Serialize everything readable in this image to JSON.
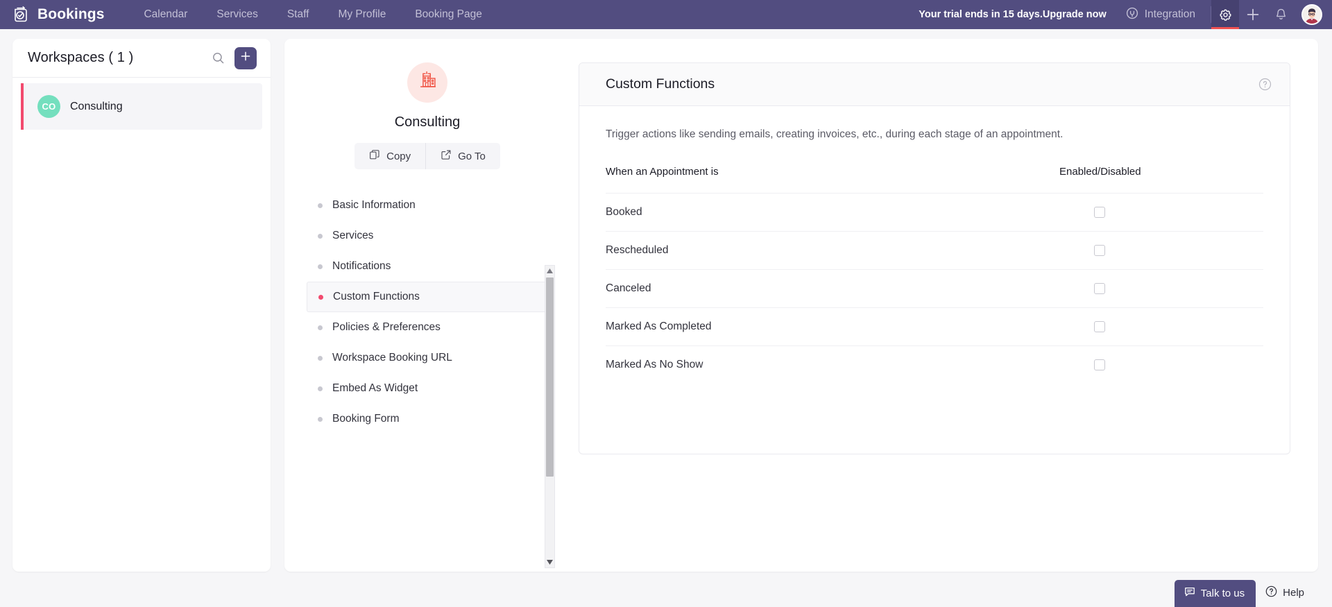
{
  "topnav": {
    "brand": "Bookings",
    "logo_icon": "bookings-logo-icon",
    "links": [
      {
        "label": "Calendar"
      },
      {
        "label": "Services"
      },
      {
        "label": "Staff"
      },
      {
        "label": "My Profile"
      },
      {
        "label": "Booking Page"
      }
    ],
    "trial_notice": "Your trial ends in 15 days.Upgrade now",
    "integration_label": "Integration",
    "integration_icon": "plug-icon",
    "settings_icon": "gear-icon",
    "add_icon": "plus-icon",
    "notifications_icon": "bell-icon",
    "avatar_icon": "user-avatar",
    "bar_color": "#524d80",
    "active_underline_color": "#f05151"
  },
  "workspaces": {
    "title": "Workspaces ( 1 )",
    "search_icon": "search-icon",
    "add_button_icon": "plus-icon",
    "items": [
      {
        "initials": "CO",
        "name": "Consulting",
        "avatar_color": "#74dfbe",
        "selected": true
      }
    ]
  },
  "workspace_detail": {
    "org_icon": "building-icon",
    "org_icon_color": "#f05141",
    "org_name": "Consulting",
    "actions": [
      {
        "label": "Copy",
        "icon": "copy-icon"
      },
      {
        "label": "Go To",
        "icon": "external-link-icon"
      }
    ],
    "menu": [
      {
        "label": "Basic Information",
        "selected": false
      },
      {
        "label": "Services",
        "selected": false
      },
      {
        "label": "Notifications",
        "selected": false
      },
      {
        "label": "Custom Functions",
        "selected": true
      },
      {
        "label": "Policies & Preferences",
        "selected": false
      },
      {
        "label": "Workspace Booking URL",
        "selected": false
      },
      {
        "label": "Embed As Widget",
        "selected": false
      },
      {
        "label": "Booking Form",
        "selected": false
      }
    ],
    "selected_dot_color": "#f24a6e"
  },
  "custom_functions": {
    "title": "Custom Functions",
    "help_icon": "help-circle-icon",
    "description": "Trigger actions like sending emails, creating invoices, etc., during each stage of an appointment.",
    "columns": [
      "When an Appointment is",
      "Enabled/Disabled"
    ],
    "rows": [
      {
        "stage": "Booked",
        "enabled": false
      },
      {
        "stage": "Rescheduled",
        "enabled": false
      },
      {
        "stage": "Canceled",
        "enabled": false
      },
      {
        "stage": "Marked As Completed",
        "enabled": false
      },
      {
        "stage": "Marked As No Show",
        "enabled": false
      }
    ]
  },
  "footer": {
    "talk_label": "Talk to us",
    "talk_icon": "chat-icon",
    "help_label": "Help",
    "help_icon": "question-circle-icon"
  }
}
